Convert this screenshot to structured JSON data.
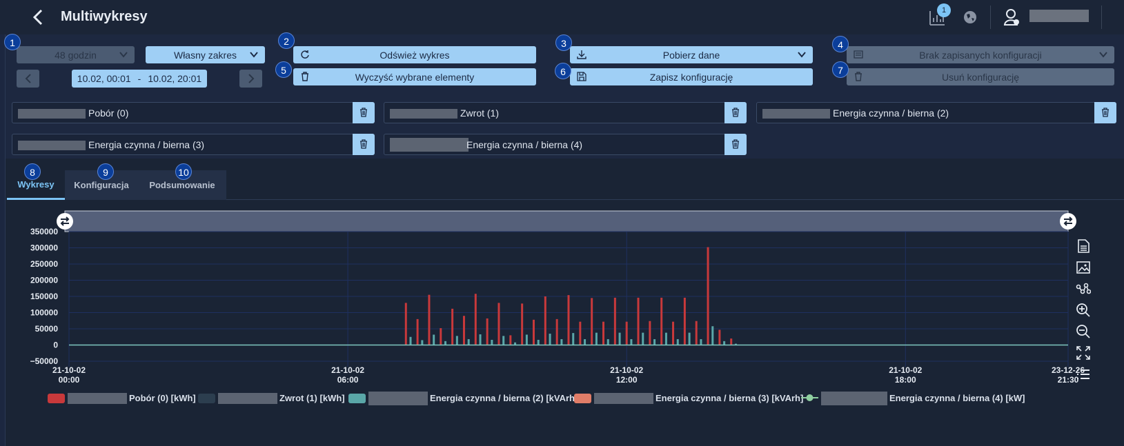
{
  "header": {
    "title": "Multiwykresy",
    "notification_count": "1"
  },
  "range": {
    "preset": "48 godzin",
    "custom": "Własny zakres",
    "from": "10.02, 00:01",
    "separator": "-",
    "to": "10.02, 20:01"
  },
  "actions": {
    "refresh": "Odśwież wykres",
    "clear": "Wyczyść wybrane elementy",
    "download": "Pobierz dane",
    "save_config": "Zapisz konfigurację",
    "no_configs": "Brak zapisanych konfiguracji",
    "delete_config": "Usuń konfigurację"
  },
  "markers": [
    "1",
    "2",
    "3",
    "4",
    "5",
    "6",
    "7",
    "8",
    "9",
    "10"
  ],
  "selected": [
    {
      "label": "Pobór (0)"
    },
    {
      "label": "Zwrot (1)"
    },
    {
      "label": "Energia czynna / bierna (2)"
    },
    {
      "label": "Energia czynna / bierna (3)"
    },
    {
      "label": "Energia czynna / bierna (4)"
    }
  ],
  "tabs": [
    {
      "label": "Wykresy",
      "active": true
    },
    {
      "label": "Konfiguracja",
      "active": false
    },
    {
      "label": "Podsumowanie",
      "active": false
    }
  ],
  "chart_data": {
    "type": "bar",
    "y_ticks": [
      "350000",
      "300000",
      "250000",
      "200000",
      "150000",
      "100000",
      "50000",
      "0",
      "−50000"
    ],
    "ylim": [
      -50000,
      350000
    ],
    "x_ticks": [
      {
        "date": "21-10-02",
        "time": "00:00",
        "hour": 0
      },
      {
        "date": "21-10-02",
        "time": "06:00",
        "hour": 6
      },
      {
        "date": "21-10-02",
        "time": "12:00",
        "hour": 12
      },
      {
        "date": "21-10-02",
        "time": "18:00",
        "hour": 18
      },
      {
        "date": "23-12-26",
        "time": "21:30",
        "hour": 21.5
      }
    ],
    "xlim_hours": [
      0,
      21.5
    ],
    "grid": true,
    "legend_position": "bottom",
    "series": [
      {
        "name": "Pobór (0) [kWh]",
        "color": "#c8393b",
        "x_hours": [
          7.25,
          7.5,
          7.75,
          8,
          8.25,
          8.5,
          8.75,
          9,
          9.25,
          9.5,
          9.75,
          10,
          10.25,
          10.5,
          10.75,
          11,
          11.25,
          11.5,
          11.75,
          12,
          12.25,
          12.5,
          12.75,
          13,
          13.25,
          13.5,
          13.75,
          14,
          14.25,
          14.5,
          14.75,
          15,
          15.25,
          15.5,
          15.75,
          16,
          16.25,
          16.5,
          16.75,
          17
        ],
        "values": [
          0,
          0,
          0,
          0,
          0,
          0,
          0,
          0,
          0,
          0,
          0,
          0,
          0,
          0,
          0,
          0,
          0,
          0,
          0,
          0,
          0,
          0,
          0,
          0,
          0,
          0,
          0,
          0,
          0,
          0,
          0,
          0,
          0,
          0,
          0,
          0,
          0,
          0,
          0,
          0
        ]
      },
      {
        "name": "Zwrot (1) [kWh]",
        "color": "#2c3e4f",
        "x_hours": [],
        "values": []
      },
      {
        "name": "Energia czynna / bierna (2) [kVArh]",
        "color": "#5aa7a8",
        "x_hours": [],
        "values": []
      },
      {
        "name": "Energia czynna / bierna (3) [kVArh]",
        "color": "#e07d68",
        "x_hours": [],
        "values": []
      },
      {
        "name": "Energia czynna / bierna (4) [kW]",
        "color": "#8fcfa0",
        "x_hours": [],
        "values": []
      }
    ],
    "bars_red": [
      [
        7.25,
        130000
      ],
      [
        7.5,
        80000
      ],
      [
        7.75,
        155000
      ],
      [
        8.0,
        52000
      ],
      [
        8.25,
        112000
      ],
      [
        8.5,
        90000
      ],
      [
        8.75,
        158000
      ],
      [
        9.0,
        82000
      ],
      [
        9.25,
        130000
      ],
      [
        9.5,
        30000
      ],
      [
        9.75,
        128000
      ],
      [
        10.0,
        78000
      ],
      [
        10.25,
        150000
      ],
      [
        10.5,
        80000
      ],
      [
        10.75,
        154000
      ],
      [
        11.0,
        72000
      ],
      [
        11.25,
        145000
      ],
      [
        11.5,
        72000
      ],
      [
        11.75,
        146000
      ],
      [
        12.0,
        72000
      ],
      [
        12.25,
        146000
      ],
      [
        12.5,
        74000
      ],
      [
        12.75,
        146000
      ],
      [
        13.0,
        72000
      ],
      [
        13.25,
        146000
      ],
      [
        13.5,
        74000
      ],
      [
        13.75,
        302000
      ],
      [
        14.0,
        47000
      ],
      [
        14.25,
        20000
      ]
    ],
    "bars_teal": [
      [
        7.35,
        25000
      ],
      [
        7.6,
        15000
      ],
      [
        7.85,
        32000
      ],
      [
        8.1,
        12000
      ],
      [
        8.35,
        28000
      ],
      [
        8.6,
        18000
      ],
      [
        8.85,
        33000
      ],
      [
        9.1,
        16000
      ],
      [
        9.35,
        28000
      ],
      [
        9.6,
        8000
      ],
      [
        9.85,
        32000
      ],
      [
        10.1,
        16000
      ],
      [
        10.35,
        35000
      ],
      [
        10.6,
        18000
      ],
      [
        10.85,
        37000
      ],
      [
        11.1,
        18000
      ],
      [
        11.35,
        38000
      ],
      [
        11.6,
        18000
      ],
      [
        11.85,
        38000
      ],
      [
        12.1,
        18000
      ],
      [
        12.35,
        38000
      ],
      [
        12.6,
        18000
      ],
      [
        12.85,
        38000
      ],
      [
        13.1,
        18000
      ],
      [
        13.35,
        38000
      ],
      [
        13.6,
        18000
      ],
      [
        13.85,
        58000
      ],
      [
        14.1,
        12000
      ],
      [
        14.35,
        4000
      ]
    ]
  }
}
